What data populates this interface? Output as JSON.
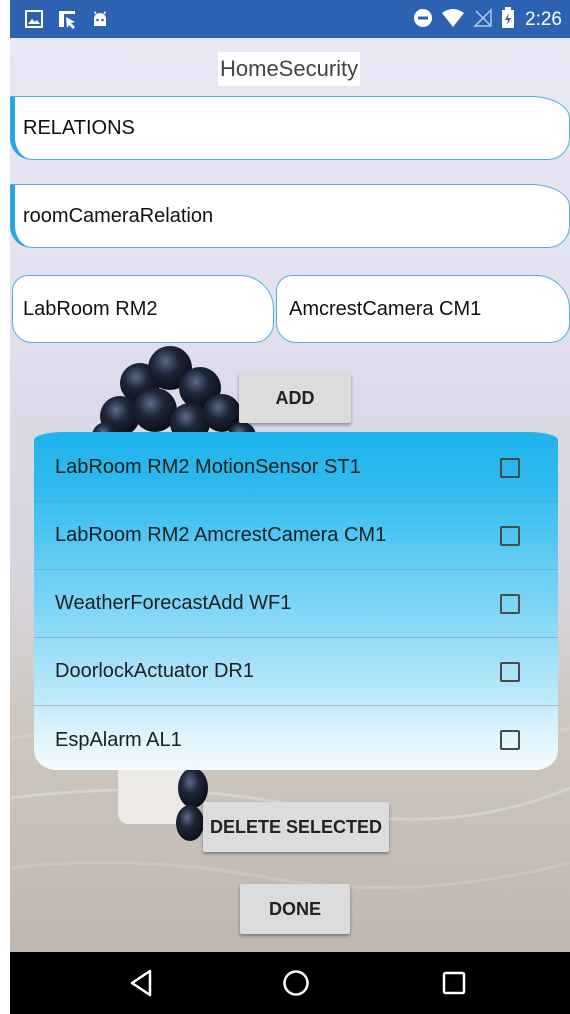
{
  "status_bar": {
    "time": "2:26",
    "left_icons": [
      "image-icon",
      "cast-icon",
      "android-icon"
    ],
    "right_icons": [
      "do-not-disturb-icon",
      "wifi-icon",
      "no-signal-icon",
      "battery-icon"
    ]
  },
  "app": {
    "title": "HomeSecurity",
    "relations_field": {
      "value": "RELATIONS"
    },
    "relation_name_field": {
      "value": "roomCameraRelation"
    },
    "room_field": {
      "value": "LabRoom RM2"
    },
    "camera_field": {
      "value": "AmcrestCamera CM1"
    },
    "add_label": "ADD",
    "list": [
      {
        "label": "LabRoom RM2 MotionSensor ST1",
        "checked": false
      },
      {
        "label": "LabRoom RM2 AmcrestCamera CM1",
        "checked": false
      },
      {
        "label": "WeatherForecastAdd WF1",
        "checked": false
      },
      {
        "label": "DoorlockActuator DR1",
        "checked": false
      },
      {
        "label": "EspAlarm AL1",
        "checked": false
      }
    ],
    "delete_label": "DELETE SELECTED",
    "done_label": "DONE"
  },
  "nav_bar": {
    "icons": [
      "back-icon",
      "home-icon",
      "recents-icon"
    ]
  },
  "colors": {
    "status_bar": "#2d62b3",
    "accent_blue": "#27a5e4",
    "list_top": "#1fb3ec",
    "button_gray": "#dcdcdc"
  }
}
